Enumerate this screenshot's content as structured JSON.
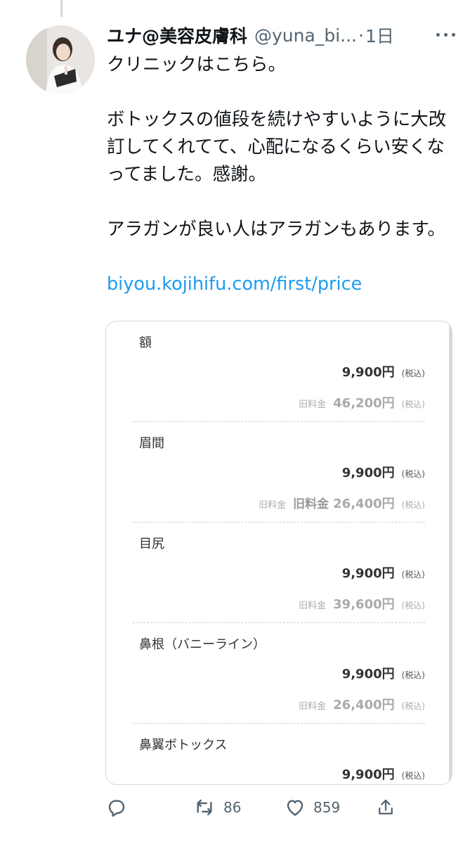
{
  "author": {
    "display_name": "ユナ@美容皮膚科",
    "handle": "@yuna_bi...",
    "separator": "·",
    "time": "1日"
  },
  "tweet": {
    "lines": [
      "クリニックはこちら。",
      "ボトックスの値段を続けやすいように大改訂してくれてて、心配になるくらい安くなってました。感謝。",
      "アラガンが良い人はアラガンもあります。"
    ],
    "link": "biyou.kojihifu.com/first/price"
  },
  "price_card": {
    "rows": [
      {
        "area": "額",
        "price": "9,900円",
        "tax": "(税込)",
        "old_label": "旧料金",
        "old_label_big": "",
        "old_price": "46,200円",
        "old_tax": "(税込)"
      },
      {
        "area": "眉間",
        "price": "9,900円",
        "tax": "(税込)",
        "old_label": "旧料金",
        "old_label_big": "旧料金",
        "old_price": "26,400円",
        "old_tax": "(税込)"
      },
      {
        "area": "目尻",
        "price": "9,900円",
        "tax": "(税込)",
        "old_label": "旧料金",
        "old_label_big": "",
        "old_price": "39,600円",
        "old_tax": "(税込)"
      },
      {
        "area": "鼻根（バニーライン）",
        "price": "9,900円",
        "tax": "(税込)",
        "old_label": "旧料金",
        "old_label_big": "",
        "old_price": "26,400円",
        "old_tax": "(税込)"
      },
      {
        "area": "鼻翼ボトックス",
        "price": "9,900円",
        "tax": "(税込)",
        "old_label": "",
        "old_label_big": "",
        "old_price": "",
        "old_tax": ""
      }
    ]
  },
  "actions": {
    "reply_icon": "reply-icon",
    "retweet_icon": "retweet-icon",
    "retweet_count": "86",
    "like_icon": "heart-icon",
    "like_count": "859",
    "share_icon": "share-icon"
  },
  "colors": {
    "link": "#1d9bf0",
    "secondary_text": "#536471",
    "primary_text": "#0f1419"
  }
}
